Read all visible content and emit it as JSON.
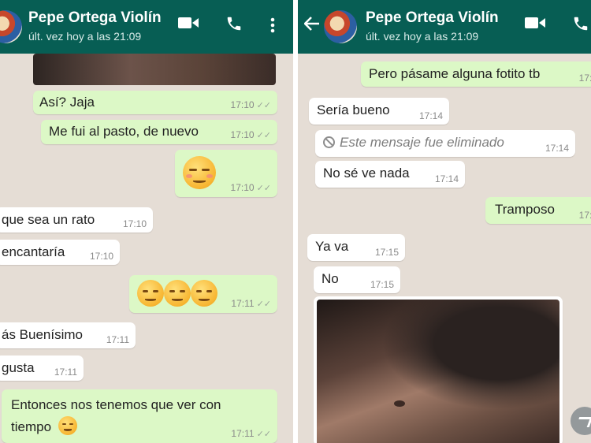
{
  "left": {
    "header": {
      "name": "Pepe Ortega Violín",
      "last_seen": "últ. vez hoy a las 21:09",
      "icons": [
        "video-icon",
        "call-icon",
        "more-icon"
      ]
    },
    "messages": [
      {
        "type": "image",
        "dir": "in"
      },
      {
        "text": "Así? Jaja",
        "time": "17:10",
        "dir": "out"
      },
      {
        "text": "Me fui al pasto, de nuevo",
        "time": "17:10",
        "dir": "out"
      },
      {
        "emoji": "blush-smile-emoji",
        "time": "17:10",
        "dir": "out"
      },
      {
        "text": "que sea un rato",
        "time": "17:10",
        "dir": "in"
      },
      {
        "text": "encantaría",
        "time": "17:10",
        "dir": "in"
      },
      {
        "emoji": "smirk-emoji ×3",
        "time": "17:11",
        "dir": "out"
      },
      {
        "text": "ás Buenísimo",
        "time": "17:11",
        "dir": "in"
      },
      {
        "text": "gusta",
        "time": "17:11",
        "dir": "in"
      },
      {
        "text_line1": "Entonces nos tenemos que ver con",
        "text_line2": "tiempo",
        "time": "17:11",
        "dir": "out"
      }
    ]
  },
  "right": {
    "header": {
      "name": "Pepe Ortega Violín",
      "last_seen": "últ. vez hoy a las 21:09",
      "icons": [
        "back-arrow-icon",
        "video-icon",
        "call-icon"
      ]
    },
    "messages": [
      {
        "text": "Pero pásame alguna fotito tb",
        "time": "17:1",
        "dir": "out"
      },
      {
        "text": "Sería bueno",
        "time": "17:14",
        "dir": "in"
      },
      {
        "text": "Este mensaje fue eliminado",
        "time": "17:14",
        "dir": "in",
        "deleted": true
      },
      {
        "text": "No sé ve nada",
        "time": "17:14",
        "dir": "in"
      },
      {
        "text": "Tramposo",
        "time": "17:1",
        "dir": "out"
      },
      {
        "text": "Ya va",
        "time": "17:15",
        "dir": "in"
      },
      {
        "text": "No",
        "time": "17:15",
        "dir": "in"
      },
      {
        "type": "image",
        "dir": "in"
      }
    ]
  },
  "colors": {
    "header": "#075e54",
    "chat_bg": "#e5ddd5",
    "outgoing": "#dcf8c6",
    "incoming": "#ffffff"
  }
}
